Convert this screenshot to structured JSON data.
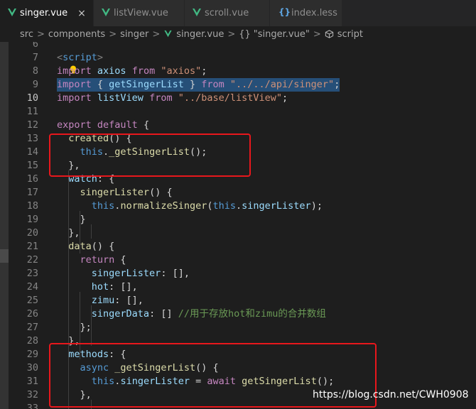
{
  "tabs": [
    {
      "label": "singer.vue",
      "active": true,
      "close": "×"
    },
    {
      "label": "listView.vue"
    },
    {
      "label": "scroll.vue"
    },
    {
      "label": "index.less"
    }
  ],
  "breadcrumb": [
    "src",
    "components",
    "singer",
    "singer.vue",
    "\"singer.vue\"",
    "script"
  ],
  "breadcrumb_sep": ">",
  "breadcrumb_braces": "{}",
  "code_lines": [
    {
      "n": "6",
      "tokens": []
    },
    {
      "n": "7",
      "tokens": [
        [
          "t",
          "<"
        ],
        [
          "b",
          "script"
        ],
        [
          "t",
          ">"
        ]
      ]
    },
    {
      "n": "8",
      "tokens": [
        [
          "k",
          "import"
        ],
        [
          "v",
          " axios "
        ],
        [
          "k",
          "from"
        ],
        [
          "s",
          " \"axios\""
        ],
        [
          "p",
          ";"
        ]
      ]
    },
    {
      "n": "9",
      "tokens": [
        [
          "k",
          "import"
        ],
        [
          "p",
          " { "
        ],
        [
          "v",
          "getSingerList"
        ],
        [
          "p",
          " } "
        ],
        [
          "k",
          "from"
        ],
        [
          "s",
          " \"../../api/singer\""
        ],
        [
          "p",
          ";"
        ]
      ],
      "selected": true
    },
    {
      "n": "10",
      "tokens": [
        [
          "k",
          "import"
        ],
        [
          "v",
          " listView "
        ],
        [
          "k",
          "from"
        ],
        [
          "s",
          " \"../base/listView\""
        ],
        [
          "p",
          ";"
        ]
      ],
      "current": true
    },
    {
      "n": "11",
      "tokens": []
    },
    {
      "n": "12",
      "tokens": [
        [
          "k",
          "export"
        ],
        [
          "k",
          " default"
        ],
        [
          "p",
          " {"
        ]
      ]
    },
    {
      "n": "13",
      "tokens": [
        [
          "p",
          "  "
        ],
        [
          "f",
          "created"
        ],
        [
          "p",
          "() {"
        ]
      ]
    },
    {
      "n": "14",
      "tokens": [
        [
          "p",
          "    "
        ],
        [
          "b",
          "this"
        ],
        [
          "p",
          "."
        ],
        [
          "f",
          "_getSingerList"
        ],
        [
          "p",
          "();"
        ]
      ]
    },
    {
      "n": "15",
      "tokens": [
        [
          "p",
          "  },"
        ]
      ]
    },
    {
      "n": "16",
      "tokens": [
        [
          "p",
          "  "
        ],
        [
          "v",
          "watch"
        ],
        [
          "p",
          ": {"
        ]
      ]
    },
    {
      "n": "17",
      "tokens": [
        [
          "p",
          "    "
        ],
        [
          "f",
          "singerLister"
        ],
        [
          "p",
          "() {"
        ]
      ]
    },
    {
      "n": "18",
      "tokens": [
        [
          "p",
          "      "
        ],
        [
          "b",
          "this"
        ],
        [
          "p",
          "."
        ],
        [
          "f",
          "normalizeSinger"
        ],
        [
          "p",
          "("
        ],
        [
          "b",
          "this"
        ],
        [
          "p",
          "."
        ],
        [
          "v",
          "singerLister"
        ],
        [
          "p",
          ");"
        ]
      ]
    },
    {
      "n": "19",
      "tokens": [
        [
          "p",
          "    }"
        ]
      ]
    },
    {
      "n": "20",
      "tokens": [
        [
          "p",
          "  },"
        ]
      ]
    },
    {
      "n": "21",
      "tokens": [
        [
          "p",
          "  "
        ],
        [
          "f",
          "data"
        ],
        [
          "p",
          "() {"
        ]
      ]
    },
    {
      "n": "22",
      "tokens": [
        [
          "p",
          "    "
        ],
        [
          "k",
          "return"
        ],
        [
          "p",
          " {"
        ]
      ]
    },
    {
      "n": "23",
      "tokens": [
        [
          "p",
          "      "
        ],
        [
          "v",
          "singerLister"
        ],
        [
          "p",
          ": [],"
        ]
      ]
    },
    {
      "n": "24",
      "tokens": [
        [
          "p",
          "      "
        ],
        [
          "v",
          "hot"
        ],
        [
          "p",
          ": [],"
        ]
      ]
    },
    {
      "n": "25",
      "tokens": [
        [
          "p",
          "      "
        ],
        [
          "v",
          "zimu"
        ],
        [
          "p",
          ": [],"
        ]
      ]
    },
    {
      "n": "26",
      "tokens": [
        [
          "p",
          "      "
        ],
        [
          "v",
          "singerData"
        ],
        [
          "p",
          ": [] "
        ],
        [
          "c",
          "//用于存放hot和zimu的合并数组"
        ]
      ]
    },
    {
      "n": "27",
      "tokens": [
        [
          "p",
          "    };"
        ]
      ]
    },
    {
      "n": "28",
      "tokens": [
        [
          "p",
          "  },"
        ]
      ]
    },
    {
      "n": "29",
      "tokens": [
        [
          "p",
          "  "
        ],
        [
          "v",
          "methods"
        ],
        [
          "p",
          ": {"
        ]
      ]
    },
    {
      "n": "30",
      "tokens": [
        [
          "p",
          "    "
        ],
        [
          "b",
          "async"
        ],
        [
          "p",
          " "
        ],
        [
          "f",
          "_getSingerList"
        ],
        [
          "p",
          "() {"
        ]
      ]
    },
    {
      "n": "31",
      "tokens": [
        [
          "p",
          "      "
        ],
        [
          "b",
          "this"
        ],
        [
          "p",
          "."
        ],
        [
          "v",
          "singerLister"
        ],
        [
          "p",
          " = "
        ],
        [
          "k",
          "await"
        ],
        [
          "p",
          " "
        ],
        [
          "f",
          "getSingerList"
        ],
        [
          "p",
          "();"
        ]
      ]
    },
    {
      "n": "32",
      "tokens": [
        [
          "p",
          "    },"
        ]
      ]
    },
    {
      "n": "33",
      "tokens": []
    }
  ],
  "watermark": "https://blog.csdn.net/CWH0908",
  "colors": {
    "highlight_box": "#e8171c",
    "selection": "#264f78",
    "vue_icon": "#41b883"
  }
}
